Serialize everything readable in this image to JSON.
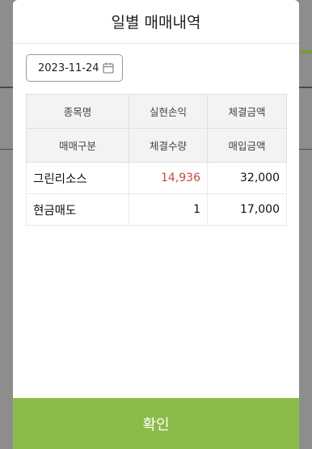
{
  "modal": {
    "title": "일별 매매내역",
    "date": "2023-11-24",
    "confirm_label": "확인"
  },
  "table": {
    "header_row1": [
      "종목명",
      "실현손익",
      "체결금액"
    ],
    "header_row2": [
      "매매구분",
      "체결수량",
      "매입금액"
    ],
    "rows": [
      [
        "그린리소스",
        "14,936",
        "32,000"
      ],
      [
        "현금매도",
        "1",
        "17,000"
      ]
    ]
  },
  "colors": {
    "profit": "#c64a3a",
    "confirm_button": "#8cbb4a"
  },
  "icons": {
    "date_picker": "calendar-icon"
  }
}
